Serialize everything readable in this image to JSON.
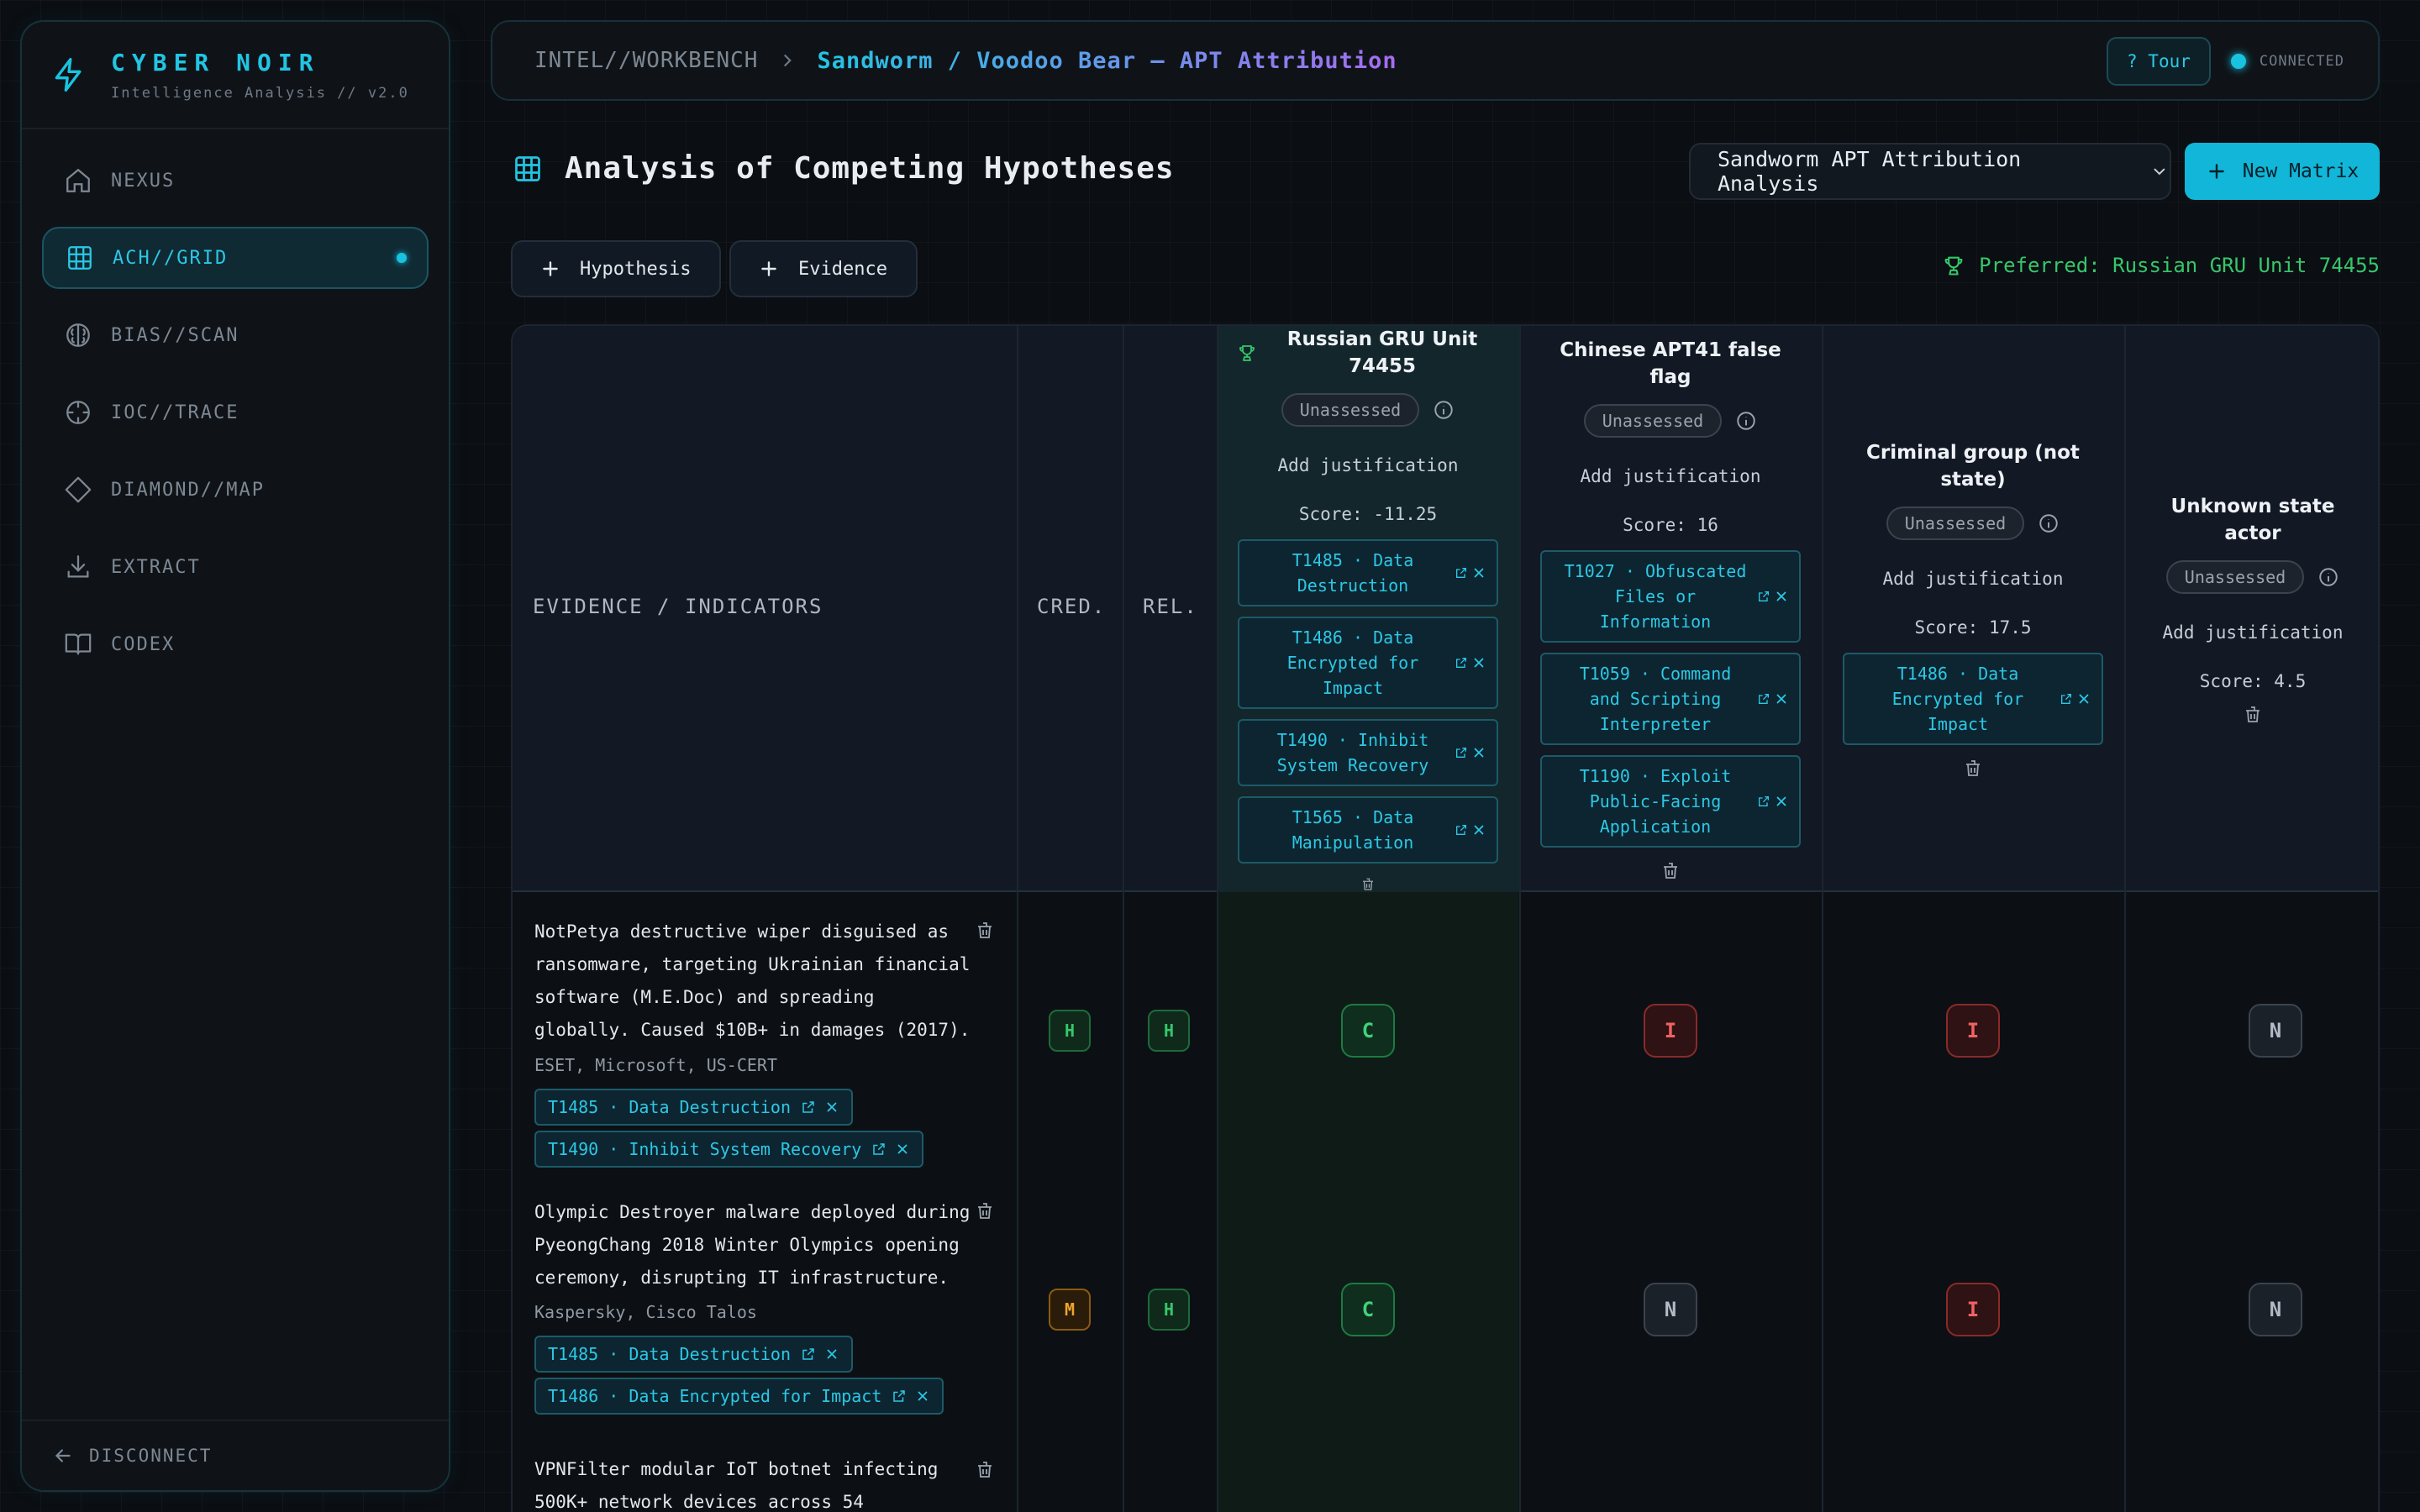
{
  "app": {
    "title": "CYBER NOIR",
    "subtitle": "Intelligence Analysis // v2.0"
  },
  "sidebar": {
    "items": [
      {
        "label": "NEXUS",
        "icon": "home-icon"
      },
      {
        "label": "ACH//GRID",
        "icon": "grid-icon",
        "active": true
      },
      {
        "label": "BIAS//SCAN",
        "icon": "brain-icon"
      },
      {
        "label": "IOC//TRACE",
        "icon": "crosshair-icon"
      },
      {
        "label": "DIAMOND//MAP",
        "icon": "diamond-icon"
      },
      {
        "label": "EXTRACT",
        "icon": "download-icon"
      },
      {
        "label": "CODEX",
        "icon": "book-icon"
      }
    ],
    "footer": "DISCONNECT"
  },
  "breadcrumb": {
    "root": "INTEL//WORKBENCH",
    "current": "Sandworm / Voodoo Bear — APT Attribution"
  },
  "topbar": {
    "tour": "? Tour",
    "status": "CONNECTED"
  },
  "page": {
    "title": "Analysis of Competing Hypotheses",
    "matrix_select": "Sandworm APT Attribution Analysis",
    "new_matrix": "New Matrix",
    "add_hypothesis": "Hypothesis",
    "add_evidence": "Evidence",
    "preferred": "Preferred: Russian GRU Unit 74455"
  },
  "matrix": {
    "headers": {
      "evidence": "EVIDENCE / INDICATORS",
      "cred": "CRED.",
      "rel": "REL."
    },
    "hypotheses": [
      {
        "name": "Russian GRU Unit 74455",
        "status": "Unassessed",
        "justification": "Add justification",
        "score": "Score: -11.25",
        "tags": [
          "T1485 · Data Destruction",
          "T1486 · Data Encrypted for Impact",
          "T1490 · Inhibit System Recovery",
          "T1565 · Data Manipulation"
        ]
      },
      {
        "name": "Chinese APT41 false flag",
        "status": "Unassessed",
        "justification": "Add justification",
        "score": "Score: 16",
        "tags": [
          "T1027 · Obfuscated Files or Information",
          "T1059 · Command and Scripting Interpreter",
          "T1190 · Exploit Public-Facing Application"
        ]
      },
      {
        "name": "Criminal group (not state)",
        "status": "Unassessed",
        "justification": "Add justification",
        "score": "Score: 17.5",
        "tags": [
          "T1486 · Data Encrypted for Impact"
        ]
      },
      {
        "name": "Unknown state actor",
        "status": "Unassessed",
        "justification": "Add justification",
        "score": "Score: 4.5",
        "tags": []
      }
    ],
    "evidence": [
      {
        "text": "NotPetya destructive wiper disguised as ransomware, targeting Ukrainian financial software (M.E.Doc) and spreading globally. Caused $10B+ in damages (2017).",
        "source": "ESET, Microsoft, US-CERT",
        "tags": [
          "T1485 · Data Destruction",
          "T1490 · Inhibit System Recovery"
        ],
        "cred": "H",
        "rel": "H",
        "ratings": [
          "C",
          "I",
          "I",
          "N"
        ]
      },
      {
        "text": "Olympic Destroyer malware deployed during PyeongChang 2018 Winter Olympics opening ceremony, disrupting IT infrastructure.",
        "source": "Kaspersky, Cisco Talos",
        "tags": [
          "T1485 · Data Destruction",
          "T1486 · Data Encrypted for Impact"
        ],
        "cred": "M",
        "rel": "H",
        "ratings": [
          "C",
          "N",
          "I",
          "N"
        ]
      },
      {
        "text": "VPNFilter modular IoT botnet infecting 500K+ network devices across 54",
        "source": "",
        "tags": []
      }
    ]
  },
  "colors": {
    "accent": "#11b6d8",
    "consistent": "#40d27a",
    "inconsistent": "#f06262",
    "medium": "#f0a52a"
  }
}
